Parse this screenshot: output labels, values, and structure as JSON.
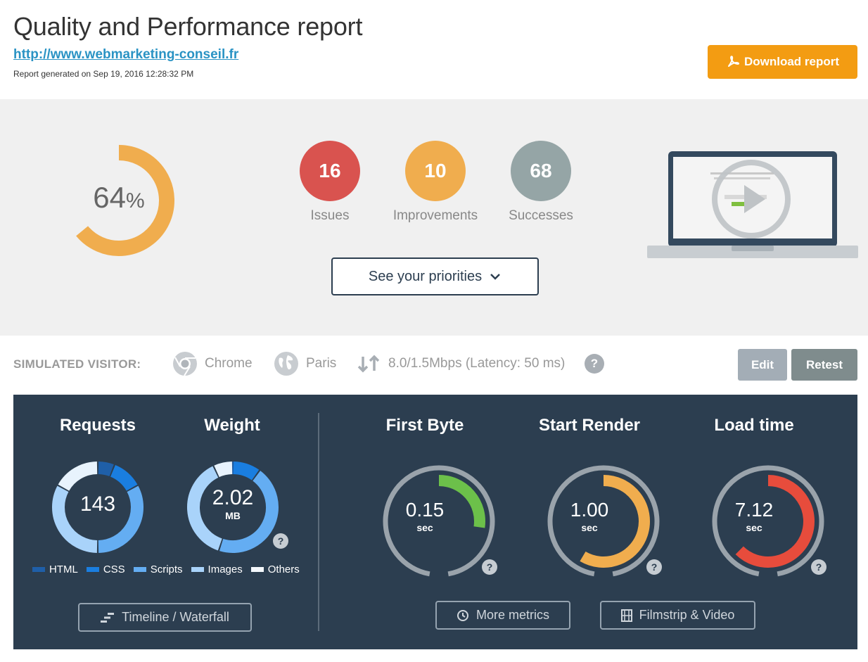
{
  "header": {
    "title": "Quality and Performance report",
    "url": "http://www.webmarketing-conseil.fr",
    "generated": "Report generated on Sep 19, 2016 12:28:32 PM",
    "download_label": "Download report"
  },
  "score": {
    "value": "64",
    "unit": "%",
    "fraction": 0.64,
    "color": "#f0ad4e"
  },
  "stats": [
    {
      "value": "16",
      "label": "Issues",
      "color": "#d9534f"
    },
    {
      "value": "10",
      "label": "Improvements",
      "color": "#f0ad4e"
    },
    {
      "value": "68",
      "label": "Successes",
      "color": "#95a5a6"
    }
  ],
  "priorities_label": "See your priorities",
  "visitor": {
    "label": "SIMULATED VISITOR:",
    "browser": "Chrome",
    "location": "Paris",
    "connection": "8.0/1.5Mbps (Latency: 50 ms)",
    "help": "?",
    "edit_label": "Edit",
    "retest_label": "Retest"
  },
  "metrics": {
    "requests": {
      "title": "Requests",
      "value": "143"
    },
    "weight": {
      "title": "Weight",
      "value": "2.02",
      "unit": "MB"
    },
    "first_byte": {
      "title": "First Byte",
      "value": "0.15",
      "unit": "sec",
      "fraction": 0.35,
      "color": "#6cc04a"
    },
    "start_render": {
      "title": "Start Render",
      "value": "1.00",
      "unit": "sec",
      "fraction": 0.75,
      "color": "#f0ad4e"
    },
    "load_time": {
      "title": "Load time",
      "value": "7.12",
      "unit": "sec",
      "fraction": 0.8,
      "color": "#e74c3c"
    },
    "help": "?",
    "legend": [
      {
        "label": "HTML",
        "color": "#1f5fa8"
      },
      {
        "label": "CSS",
        "color": "#1a7ee0"
      },
      {
        "label": "Scripts",
        "color": "#64adf2"
      },
      {
        "label": "Images",
        "color": "#a9d3fa"
      },
      {
        "label": "Others",
        "color": "#e8f3fd"
      }
    ],
    "timeline_label": "Timeline / Waterfall",
    "more_metrics_label": "More metrics",
    "filmstrip_label": "Filmstrip & Video"
  }
}
